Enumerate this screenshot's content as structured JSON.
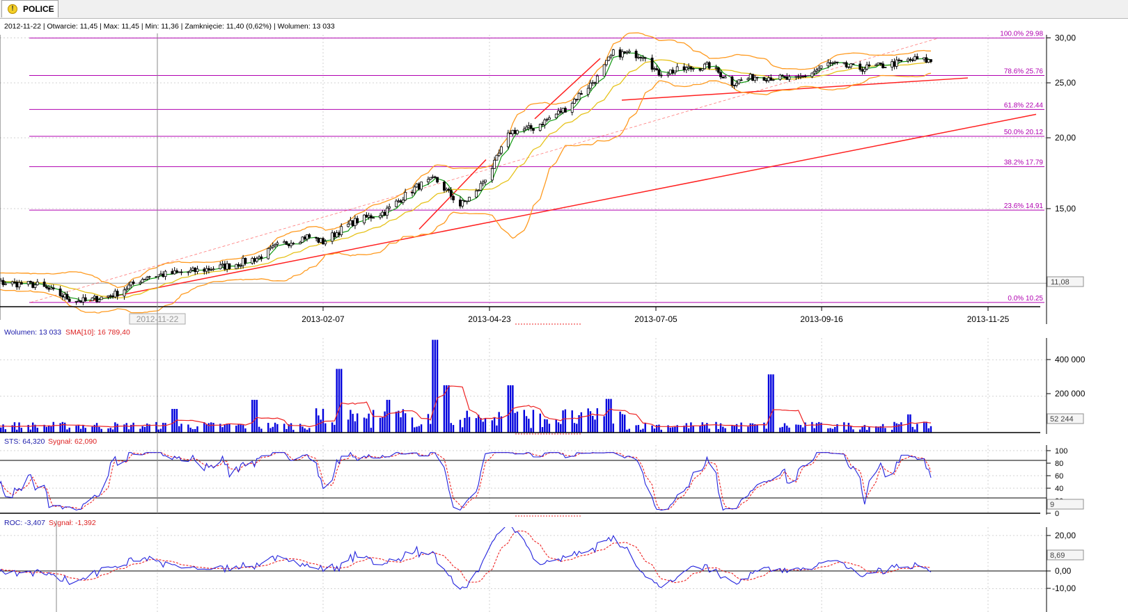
{
  "tab": {
    "title": "POLICE",
    "icon": "warning-icon"
  },
  "price_panel": {
    "header": "2012-11-22 | Otwarcie: 11,45 | Max: 11,45 | Min: 11,36 | Zamknięcie: 11,40 (0,62%)  | Wolumen: 13 033",
    "y_ticks": [
      "30,00",
      "25,00",
      "20,00",
      "15,00"
    ],
    "current_value": "11,08",
    "fibonacci": [
      {
        "label": "100.0% 29.98",
        "level": 29.98
      },
      {
        "label": "78.6% 25.76",
        "level": 25.76
      },
      {
        "label": "61.8% 22.44",
        "level": 22.44
      },
      {
        "label": "50.0% 20.12",
        "level": 20.12
      },
      {
        "label": "38.2% 17.79",
        "level": 17.79
      },
      {
        "label": "23.6% 14.91",
        "level": 14.91
      },
      {
        "label": "0.0% 10.25",
        "level": 10.25
      }
    ]
  },
  "x_axis": {
    "cursor_date": "2012-11-22",
    "labels": [
      "2013-02-07",
      "2013-04-23",
      "2013-07-05",
      "2013-09-16",
      "2013-11-25"
    ]
  },
  "volume_panel": {
    "legend_volume": "Wolumen: 13 033",
    "legend_sma": "SMA[10]: 16 789,40",
    "y_ticks": [
      "400 000",
      "200 000"
    ],
    "current_value": "52 244"
  },
  "sts_panel": {
    "legend_main": "STS: 64,320",
    "legend_signal": "Sygnał: 62,090",
    "y_ticks": [
      "100",
      "80",
      "60",
      "40",
      "20",
      "0"
    ],
    "current_value": "9"
  },
  "roc_panel": {
    "legend_main": "ROC: -3,407",
    "legend_signal": "Sygnał: -1,392",
    "y_ticks": [
      "20,00",
      "0,00",
      "-10,00"
    ],
    "current_value": "8,69"
  },
  "colors": {
    "candle": "#000000",
    "bollinger": "#ff9a1f",
    "ma_short": "#119911",
    "ma_long": "#e6c21a",
    "fib": "#b000b0",
    "trend": "#ff2020",
    "volume": "#0000dd",
    "sma": "#ee2222",
    "osc": "#2222dd",
    "signal": "#ee2222"
  },
  "chart_data": [
    {
      "type": "candlestick",
      "title": "POLICE",
      "x": [
        "2012-09-03",
        "2013-10-31"
      ],
      "x_ticks": [
        "2013-02-07",
        "2013-04-23",
        "2013-07-05",
        "2013-09-16",
        "2013-11-25"
      ],
      "ylim": [
        10.0,
        30.5
      ],
      "close_anchors": [
        [
          "2012-09-03",
          11.2
        ],
        [
          "2012-09-20",
          11.1
        ],
        [
          "2012-10-05",
          11.0
        ],
        [
          "2012-10-19",
          10.4
        ],
        [
          "2012-10-26",
          10.3
        ],
        [
          "2012-11-08",
          10.6
        ],
        [
          "2012-11-22",
          11.4
        ],
        [
          "2012-12-10",
          11.6
        ],
        [
          "2012-12-28",
          11.9
        ],
        [
          "2013-01-10",
          12.3
        ],
        [
          "2013-01-18",
          12.9
        ],
        [
          "2013-01-31",
          13.4
        ],
        [
          "2013-02-07",
          13.1
        ],
        [
          "2013-02-20",
          14.2
        ],
        [
          "2013-03-06",
          14.8
        ],
        [
          "2013-03-20",
          16.4
        ],
        [
          "2013-03-28",
          16.9
        ],
        [
          "2013-04-08",
          15.2
        ],
        [
          "2013-04-15",
          16.0
        ],
        [
          "2013-04-23",
          18.0
        ],
        [
          "2013-04-30",
          20.5
        ],
        [
          "2013-05-10",
          20.8
        ],
        [
          "2013-05-24",
          22.5
        ],
        [
          "2013-06-07",
          25.5
        ],
        [
          "2013-06-14",
          28.2
        ],
        [
          "2013-06-28",
          28.0
        ],
        [
          "2013-07-03",
          26.0
        ],
        [
          "2013-07-12",
          26.3
        ],
        [
          "2013-07-26",
          26.8
        ],
        [
          "2013-08-05",
          25.0
        ],
        [
          "2013-08-16",
          25.7
        ],
        [
          "2013-09-02",
          25.3
        ],
        [
          "2013-09-10",
          26.2
        ],
        [
          "2013-09-16",
          27.0
        ],
        [
          "2013-09-30",
          26.5
        ],
        [
          "2013-10-10",
          26.8
        ],
        [
          "2013-10-24",
          27.5
        ],
        [
          "2013-10-31",
          27.3
        ]
      ],
      "indicators": [
        "Bollinger Bands",
        "Moving Average (short)",
        "Moving Average (long)"
      ],
      "fibonacci_levels": [
        29.98,
        25.76,
        22.44,
        20.12,
        17.79,
        14.91,
        10.25
      ],
      "current_price_marker": 11.08
    },
    {
      "type": "bar",
      "title": "Wolumen",
      "series": [
        {
          "name": "Wolumen",
          "last": 13033
        },
        {
          "name": "SMA[10]",
          "last": 16789.4
        }
      ],
      "ylim": [
        0,
        520000
      ],
      "y_ticks": [
        400000,
        200000
      ],
      "spikes": [
        [
          "2012-09-03",
          180000
        ],
        [
          "2012-12-04",
          130000
        ],
        [
          "2013-01-08",
          180000
        ],
        [
          "2013-02-14",
          350000
        ],
        [
          "2013-03-08",
          180000
        ],
        [
          "2013-03-28",
          510000
        ],
        [
          "2013-04-02",
          260000
        ],
        [
          "2013-04-30",
          260000
        ],
        [
          "2013-06-12",
          185000
        ],
        [
          "2013-08-22",
          320000
        ],
        [
          "2013-10-21",
          100000
        ]
      ],
      "current_value": 52244
    },
    {
      "type": "line",
      "title": "STS",
      "series": [
        {
          "name": "STS",
          "last": 64.32
        },
        {
          "name": "Sygnał",
          "last": 62.09
        }
      ],
      "ylim": [
        0,
        100
      ],
      "reference_lines": [
        80,
        20
      ],
      "current_value": 9
    },
    {
      "type": "line",
      "title": "ROC",
      "series": [
        {
          "name": "ROC",
          "last": -3.407
        },
        {
          "name": "Sygnał",
          "last": -1.392
        }
      ],
      "ylim": [
        -12,
        24
      ],
      "reference_lines": [
        0
      ],
      "current_value": 8.69
    }
  ]
}
